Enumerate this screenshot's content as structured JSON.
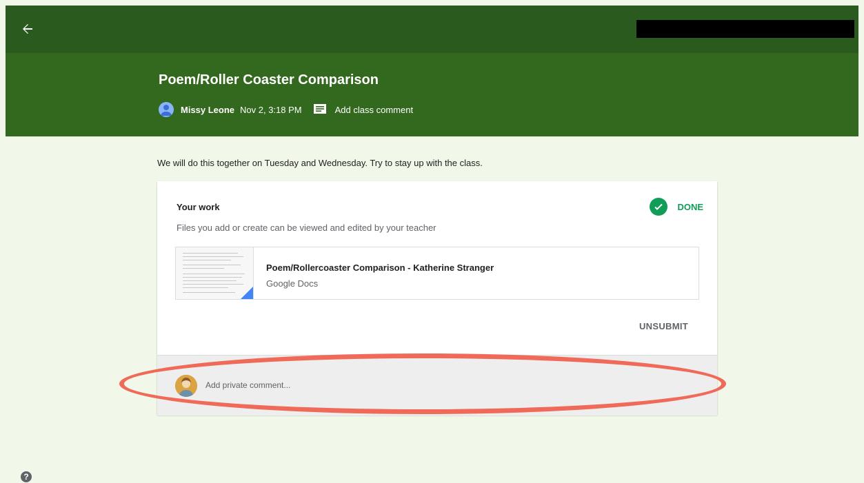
{
  "header": {
    "title": "Poem/Roller Coaster Comparison",
    "teacher_name": "Missy Leone",
    "posted_date": "Nov 2, 3:18 PM",
    "class_comment_label": "Add class comment"
  },
  "description": "We will do this together on Tuesday and Wednesday. Try to stay up with the class.",
  "your_work": {
    "title": "Your work",
    "subtitle": "Files you add or create can be viewed and edited by your teacher",
    "status": "DONE",
    "status_color": "#0f9d58",
    "file": {
      "name": "Poem/Rollercoaster Comparison - Katherine Stranger",
      "type": "Google Docs"
    },
    "unsubmit_label": "UNSUBMIT"
  },
  "private_comment": {
    "placeholder": "Add private comment..."
  },
  "colors": {
    "topbar": "#2b5a1e",
    "header": "#33691e",
    "background": "#f1f8e9",
    "highlight": "#f06a5a"
  },
  "icons": [
    "back-arrow-icon",
    "comment-icon",
    "check-icon",
    "help-icon"
  ]
}
